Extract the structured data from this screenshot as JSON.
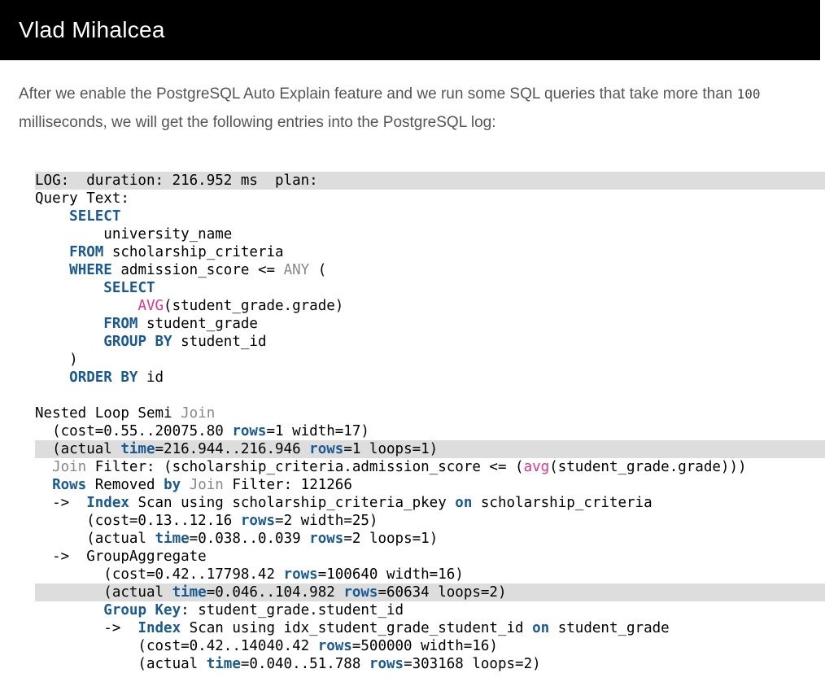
{
  "header": {
    "title": "Vlad Mihalcea"
  },
  "intro": {
    "before": "After we enable the PostgreSQL Auto Explain feature and we run some SQL queries that take more than ",
    "code": "100",
    "after": " milliseconds, we will get the following entries into the PostgreSQL log:"
  },
  "colors": {
    "keyword": "#1a5a93",
    "operator": "#888888",
    "function": "#e0338d",
    "highlight": "#dddddd"
  },
  "code_lines": [
    {
      "hl": true,
      "tokens": [
        [
          "",
          "LOG:  duration: 216.952 ms  plan:"
        ]
      ]
    },
    {
      "hl": false,
      "tokens": [
        [
          "",
          "Query Text:"
        ]
      ]
    },
    {
      "hl": false,
      "tokens": [
        [
          "",
          "    "
        ],
        [
          "kw",
          "SELECT"
        ]
      ]
    },
    {
      "hl": false,
      "tokens": [
        [
          "",
          "        university_name"
        ]
      ]
    },
    {
      "hl": false,
      "tokens": [
        [
          "",
          "    "
        ],
        [
          "kw",
          "FROM"
        ],
        [
          "",
          " scholarship_criteria"
        ]
      ]
    },
    {
      "hl": false,
      "tokens": [
        [
          "",
          "    "
        ],
        [
          "kw",
          "WHERE"
        ],
        [
          "",
          " admission_score <= "
        ],
        [
          "op",
          "ANY"
        ],
        [
          "",
          " ("
        ]
      ]
    },
    {
      "hl": false,
      "tokens": [
        [
          "",
          "        "
        ],
        [
          "kw",
          "SELECT"
        ]
      ]
    },
    {
      "hl": false,
      "tokens": [
        [
          "",
          "            "
        ],
        [
          "fn",
          "AVG"
        ],
        [
          "",
          "(student_grade.grade)"
        ]
      ]
    },
    {
      "hl": false,
      "tokens": [
        [
          "",
          "        "
        ],
        [
          "kw",
          "FROM"
        ],
        [
          "",
          " student_grade"
        ]
      ]
    },
    {
      "hl": false,
      "tokens": [
        [
          "",
          "        "
        ],
        [
          "kw",
          "GROUP BY"
        ],
        [
          "",
          " student_id"
        ]
      ]
    },
    {
      "hl": false,
      "tokens": [
        [
          "",
          "    )"
        ]
      ]
    },
    {
      "hl": false,
      "tokens": [
        [
          "",
          "    "
        ],
        [
          "kw",
          "ORDER BY"
        ],
        [
          "",
          " id"
        ]
      ]
    },
    {
      "hl": false,
      "tokens": [
        [
          "",
          ""
        ]
      ]
    },
    {
      "hl": false,
      "tokens": [
        [
          "",
          "Nested Loop Semi "
        ],
        [
          "op",
          "Join"
        ]
      ]
    },
    {
      "hl": false,
      "tokens": [
        [
          "",
          "  (cost=0.55..20075.80 "
        ],
        [
          "kw",
          "rows"
        ],
        [
          "",
          "=1 width=17)"
        ]
      ]
    },
    {
      "hl": true,
      "tokens": [
        [
          "",
          "  (actual "
        ],
        [
          "kw",
          "time"
        ],
        [
          "",
          "=216.944..216.946 "
        ],
        [
          "kw",
          "rows"
        ],
        [
          "",
          "=1 loops=1)"
        ]
      ]
    },
    {
      "hl": false,
      "tokens": [
        [
          "",
          "  "
        ],
        [
          "op",
          "Join"
        ],
        [
          "",
          " Filter: (scholarship_criteria.admission_score <= ("
        ],
        [
          "fn",
          "avg"
        ],
        [
          "",
          "(student_grade.grade)))"
        ]
      ]
    },
    {
      "hl": false,
      "tokens": [
        [
          "",
          "  "
        ],
        [
          "kw",
          "Rows"
        ],
        [
          "",
          " Removed "
        ],
        [
          "kw",
          "by"
        ],
        [
          "",
          " "
        ],
        [
          "op",
          "Join"
        ],
        [
          "",
          " Filter: 121266"
        ]
      ]
    },
    {
      "hl": false,
      "tokens": [
        [
          "",
          "  ->  "
        ],
        [
          "kw",
          "Index"
        ],
        [
          "",
          " Scan using scholarship_criteria_pkey "
        ],
        [
          "kw",
          "on"
        ],
        [
          "",
          " scholarship_criteria"
        ]
      ]
    },
    {
      "hl": false,
      "tokens": [
        [
          "",
          "      (cost=0.13..12.16 "
        ],
        [
          "kw",
          "rows"
        ],
        [
          "",
          "=2 width=25)"
        ]
      ]
    },
    {
      "hl": false,
      "tokens": [
        [
          "",
          "      (actual "
        ],
        [
          "kw",
          "time"
        ],
        [
          "",
          "=0.038..0.039 "
        ],
        [
          "kw",
          "rows"
        ],
        [
          "",
          "=2 loops=1)"
        ]
      ]
    },
    {
      "hl": false,
      "tokens": [
        [
          "",
          "  ->  GroupAggregate"
        ]
      ]
    },
    {
      "hl": false,
      "tokens": [
        [
          "",
          "        (cost=0.42..17798.42 "
        ],
        [
          "kw",
          "rows"
        ],
        [
          "",
          "=100640 width=16)"
        ]
      ]
    },
    {
      "hl": true,
      "tokens": [
        [
          "",
          "        (actual "
        ],
        [
          "kw",
          "time"
        ],
        [
          "",
          "=0.046..104.982 "
        ],
        [
          "kw",
          "rows"
        ],
        [
          "",
          "=60634 loops=2)"
        ]
      ]
    },
    {
      "hl": false,
      "tokens": [
        [
          "",
          "        "
        ],
        [
          "kw",
          "Group Key"
        ],
        [
          "",
          ": student_grade.student_id"
        ]
      ]
    },
    {
      "hl": false,
      "tokens": [
        [
          "",
          "        ->  "
        ],
        [
          "kw",
          "Index"
        ],
        [
          "",
          " Scan using idx_student_grade_student_id "
        ],
        [
          "kw",
          "on"
        ],
        [
          "",
          " student_grade"
        ]
      ]
    },
    {
      "hl": false,
      "tokens": [
        [
          "",
          "            (cost=0.42..14040.42 "
        ],
        [
          "kw",
          "rows"
        ],
        [
          "",
          "=500000 width=16)"
        ]
      ]
    },
    {
      "hl": false,
      "tokens": [
        [
          "",
          "            (actual "
        ],
        [
          "kw",
          "time"
        ],
        [
          "",
          "=0.040..51.788 "
        ],
        [
          "kw",
          "rows"
        ],
        [
          "",
          "=303168 loops=2)"
        ]
      ]
    }
  ]
}
